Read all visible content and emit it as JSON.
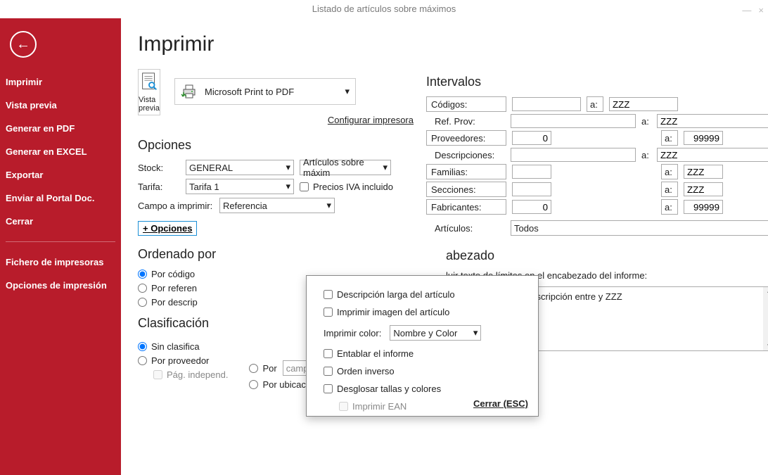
{
  "window": {
    "title": "Listado de artículos sobre máximos",
    "minimize_icon": "—",
    "close_icon": "×"
  },
  "sidebar": {
    "back_glyph": "←",
    "items": [
      {
        "label": "Imprimir"
      },
      {
        "label": "Vista previa"
      },
      {
        "label": "Generar en PDF"
      },
      {
        "label": "Generar en EXCEL"
      },
      {
        "label": "Exportar"
      },
      {
        "label": "Enviar al Portal Doc."
      },
      {
        "label": "Cerrar"
      }
    ],
    "items2": [
      {
        "label": "Fichero de impresoras"
      },
      {
        "label": "Opciones de impresión"
      }
    ]
  },
  "main": {
    "title": "Imprimir",
    "preview": {
      "label": "Vista previa"
    },
    "printer": {
      "name": "Microsoft Print to PDF"
    },
    "config_link": "Configurar impresora",
    "opciones": {
      "heading": "Opciones",
      "stock_label": "Stock:",
      "stock_value": "GENERAL",
      "stock_filter": "Artículos sobre máxim",
      "tarifa_label": "Tarifa:",
      "tarifa_value": "Tarifa 1",
      "iva_label": "Precios IVA incluido",
      "campo_label": "Campo a imprimir:",
      "campo_value": "Referencia",
      "more": "+ Opciones"
    },
    "orden": {
      "heading": "Ordenado por",
      "r1": "Por código",
      "r2": "Por referen",
      "r3": "Por descrip"
    },
    "clasif": {
      "heading": "Clasificación",
      "r1": "Sin clasifica",
      "r2": "Por proveedor",
      "sub": "Pág. independ.",
      "r3": "Por",
      "r3_sel": "campo modificado",
      "r4": "Por ubicación"
    },
    "intervalos": {
      "heading": "Intervalos",
      "codigos": "Códigos:",
      "codigos_to": "ZZZ",
      "refprov": "Ref. Prov:",
      "refprov_to": "ZZZ",
      "proveedores": "Proveedores:",
      "prov_from": "0",
      "prov_to": "99999",
      "descripciones": "Descripciones:",
      "desc_to": "ZZZ",
      "familias": "Familias:",
      "fam_to": "ZZZ",
      "secciones": "Secciones:",
      "sec_to": "ZZZ",
      "fabricantes": "Fabricantes:",
      "fab_from": "0",
      "fab_to": "99999",
      "articulos_label": "Artículos:",
      "articulos_value": "Todos",
      "a": "a:"
    },
    "encabezado": {
      "heading_tail": "abezado",
      "desc": "luir texto de límites en el encabezado del informe:",
      "value": "Artículos entre  y ZZZ y descripción entre  y ZZZ",
      "up": "▲",
      "down": "▼"
    }
  },
  "popup": {
    "c1": "Descripción larga del artículo",
    "c2": "Imprimir imagen del artículo",
    "color_label": "Imprimir color:",
    "color_value": "Nombre y Color",
    "c3": "Entablar el informe",
    "c4": "Orden inverso",
    "c5": "Desglosar tallas y colores",
    "c6": "Imprimir EAN",
    "close": "Cerrar (ESC)"
  }
}
